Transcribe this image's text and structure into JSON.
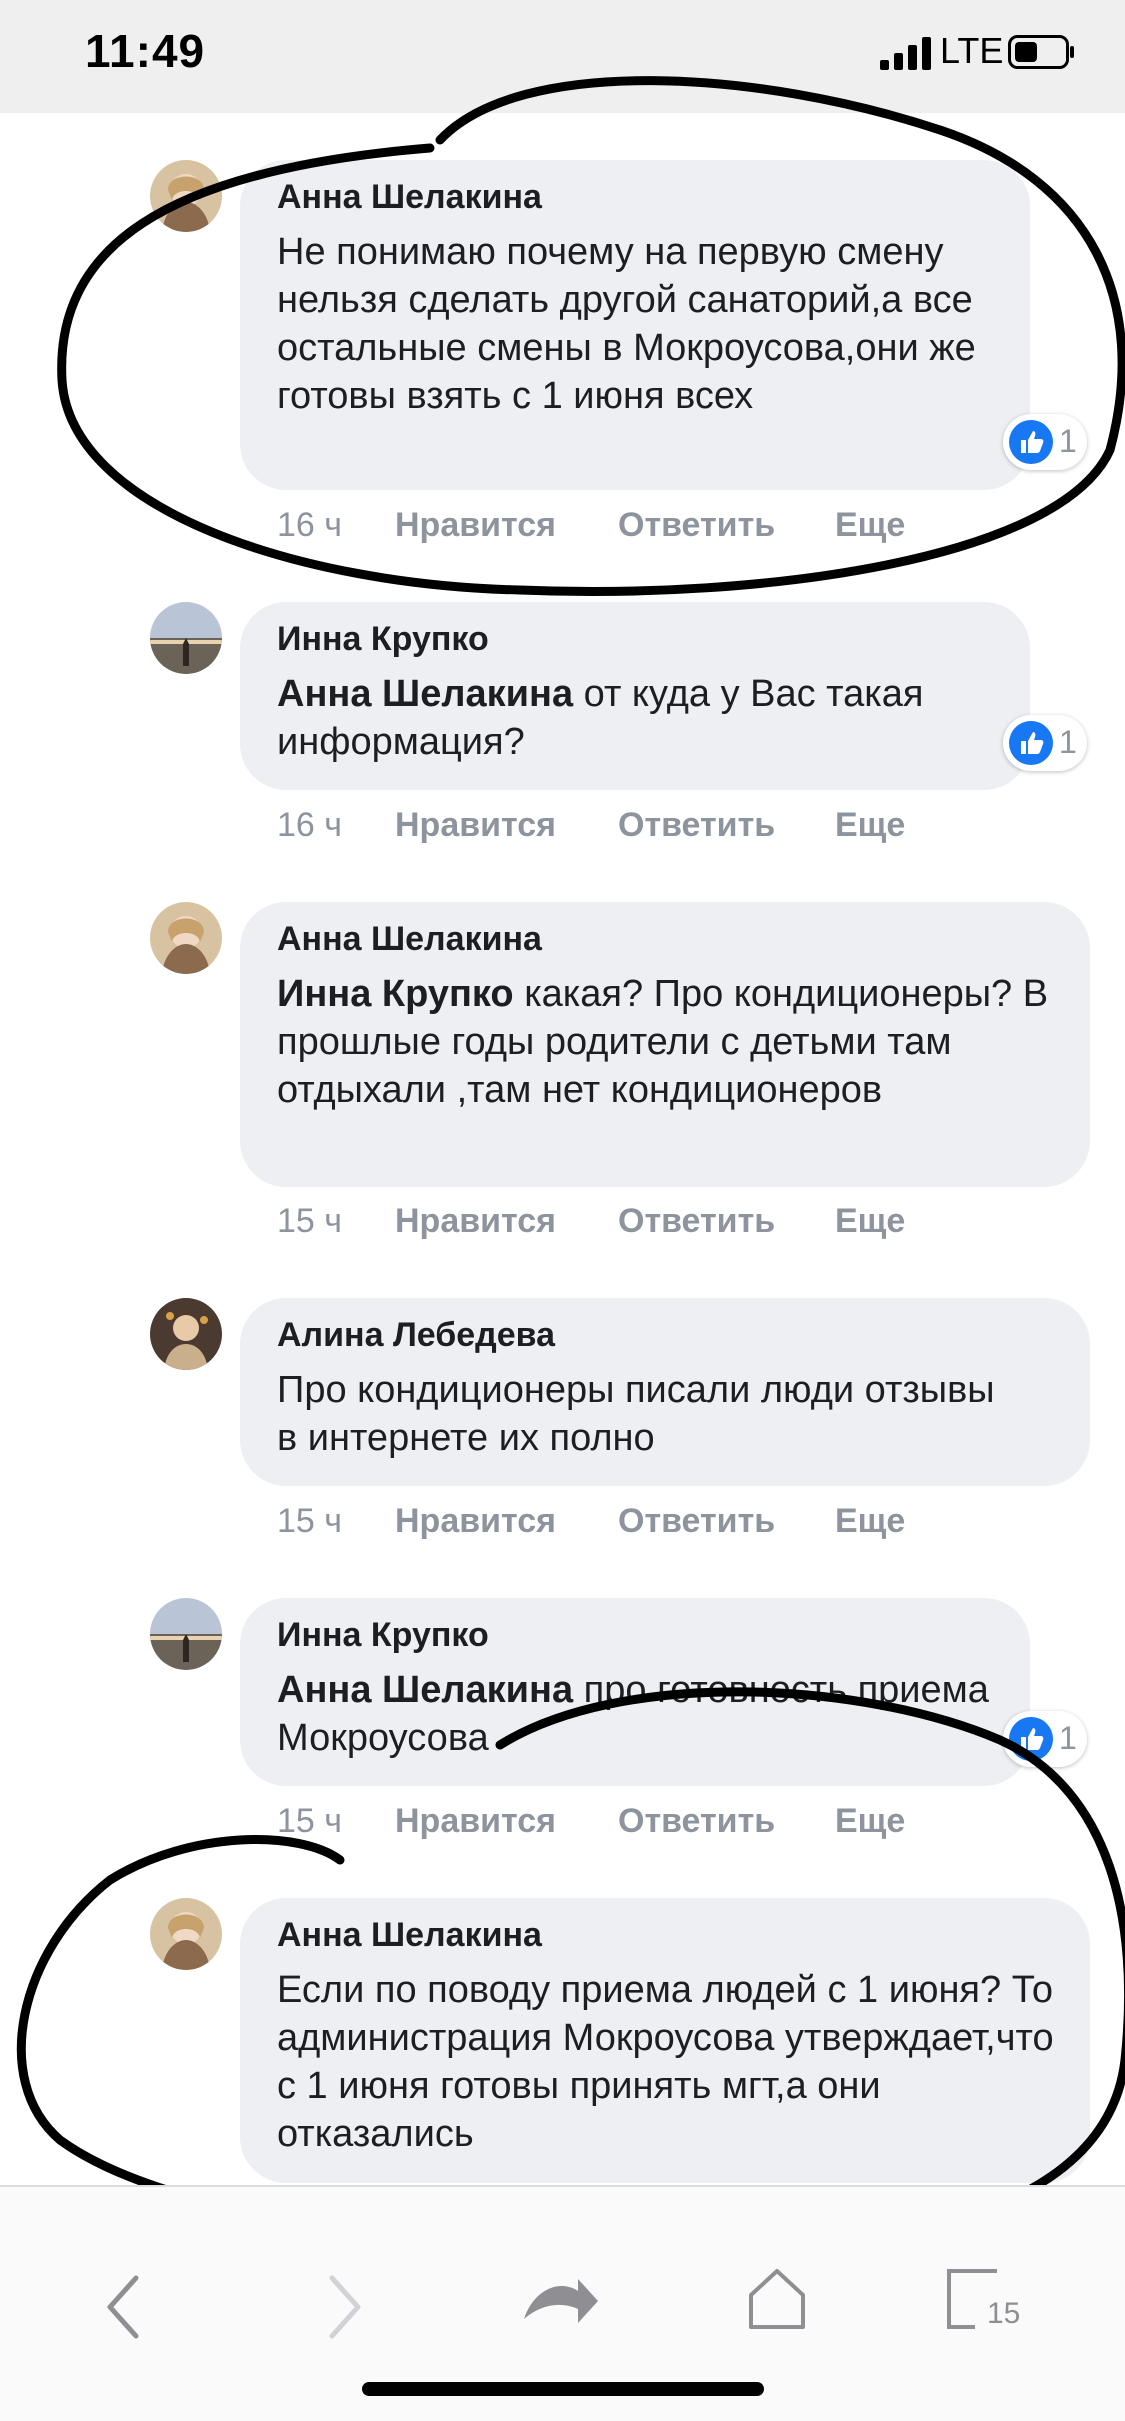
{
  "status_bar": {
    "time": "11:49",
    "network": "LTE"
  },
  "comments": [
    {
      "author": "Анна Шелакина",
      "mention": "",
      "text": "Не понимаю почему на первую смену нельзя сделать другой санаторий,а все остальные смены в Мокроусова,они же готовы взять с 1 июня всех",
      "time": "16 ч",
      "reactions": "1"
    },
    {
      "author": "Инна Крупко",
      "mention": "Анна Шелакина",
      "text": " от куда у Вас такая информация?",
      "time": "16 ч",
      "reactions": "1"
    },
    {
      "author": "Анна Шелакина",
      "mention": "Инна Крупко",
      "text": " какая? Про кондиционеры? В прошлые годы родители с детьми там отдыхали ,там нет кондиционеров",
      "time": "15 ч",
      "reactions": ""
    },
    {
      "author": "Алина Лебедева",
      "mention": "",
      "text": "Про кондиционеры писали люди отзывы в интернете их полно",
      "time": "15 ч",
      "reactions": ""
    },
    {
      "author": "Инна Крупко",
      "mention": "Анна Шелакина",
      "text": " про готовность приема Мокроусова",
      "time": "15 ч",
      "reactions": "1"
    },
    {
      "author": "Анна Шелакина",
      "mention": "",
      "text": "Если по поводу приема людей с 1 июня? То администрация Мокроусова утверждает,что с 1 июня готовы принять мгт,а они отказались",
      "time": "",
      "reactions": ""
    }
  ],
  "actions": {
    "like": "Нравится",
    "reply": "Ответить",
    "more": "Еще"
  },
  "toolbar": {
    "tabs_count": "15"
  },
  "icons": [
    "like-icon",
    "back-icon",
    "forward-icon",
    "share-icon",
    "home-icon",
    "tabs-icon"
  ],
  "colors": {
    "bubble": "#eeeff2",
    "like_blue": "#1877f2",
    "meta_gray": "#8d949e",
    "annotation": "#000000"
  }
}
